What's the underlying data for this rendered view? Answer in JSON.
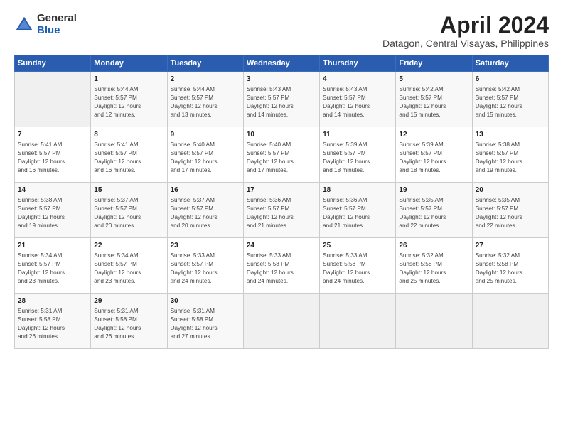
{
  "logo": {
    "general": "General",
    "blue": "Blue"
  },
  "title": "April 2024",
  "subtitle": "Datagon, Central Visayas, Philippines",
  "header_days": [
    "Sunday",
    "Monday",
    "Tuesday",
    "Wednesday",
    "Thursday",
    "Friday",
    "Saturday"
  ],
  "weeks": [
    [
      {
        "day": "",
        "info": ""
      },
      {
        "day": "1",
        "info": "Sunrise: 5:44 AM\nSunset: 5:57 PM\nDaylight: 12 hours\nand 12 minutes."
      },
      {
        "day": "2",
        "info": "Sunrise: 5:44 AM\nSunset: 5:57 PM\nDaylight: 12 hours\nand 13 minutes."
      },
      {
        "day": "3",
        "info": "Sunrise: 5:43 AM\nSunset: 5:57 PM\nDaylight: 12 hours\nand 14 minutes."
      },
      {
        "day": "4",
        "info": "Sunrise: 5:43 AM\nSunset: 5:57 PM\nDaylight: 12 hours\nand 14 minutes."
      },
      {
        "day": "5",
        "info": "Sunrise: 5:42 AM\nSunset: 5:57 PM\nDaylight: 12 hours\nand 15 minutes."
      },
      {
        "day": "6",
        "info": "Sunrise: 5:42 AM\nSunset: 5:57 PM\nDaylight: 12 hours\nand 15 minutes."
      }
    ],
    [
      {
        "day": "7",
        "info": "Sunrise: 5:41 AM\nSunset: 5:57 PM\nDaylight: 12 hours\nand 16 minutes."
      },
      {
        "day": "8",
        "info": "Sunrise: 5:41 AM\nSunset: 5:57 PM\nDaylight: 12 hours\nand 16 minutes."
      },
      {
        "day": "9",
        "info": "Sunrise: 5:40 AM\nSunset: 5:57 PM\nDaylight: 12 hours\nand 17 minutes."
      },
      {
        "day": "10",
        "info": "Sunrise: 5:40 AM\nSunset: 5:57 PM\nDaylight: 12 hours\nand 17 minutes."
      },
      {
        "day": "11",
        "info": "Sunrise: 5:39 AM\nSunset: 5:57 PM\nDaylight: 12 hours\nand 18 minutes."
      },
      {
        "day": "12",
        "info": "Sunrise: 5:39 AM\nSunset: 5:57 PM\nDaylight: 12 hours\nand 18 minutes."
      },
      {
        "day": "13",
        "info": "Sunrise: 5:38 AM\nSunset: 5:57 PM\nDaylight: 12 hours\nand 19 minutes."
      }
    ],
    [
      {
        "day": "14",
        "info": "Sunrise: 5:38 AM\nSunset: 5:57 PM\nDaylight: 12 hours\nand 19 minutes."
      },
      {
        "day": "15",
        "info": "Sunrise: 5:37 AM\nSunset: 5:57 PM\nDaylight: 12 hours\nand 20 minutes."
      },
      {
        "day": "16",
        "info": "Sunrise: 5:37 AM\nSunset: 5:57 PM\nDaylight: 12 hours\nand 20 minutes."
      },
      {
        "day": "17",
        "info": "Sunrise: 5:36 AM\nSunset: 5:57 PM\nDaylight: 12 hours\nand 21 minutes."
      },
      {
        "day": "18",
        "info": "Sunrise: 5:36 AM\nSunset: 5:57 PM\nDaylight: 12 hours\nand 21 minutes."
      },
      {
        "day": "19",
        "info": "Sunrise: 5:35 AM\nSunset: 5:57 PM\nDaylight: 12 hours\nand 22 minutes."
      },
      {
        "day": "20",
        "info": "Sunrise: 5:35 AM\nSunset: 5:57 PM\nDaylight: 12 hours\nand 22 minutes."
      }
    ],
    [
      {
        "day": "21",
        "info": "Sunrise: 5:34 AM\nSunset: 5:57 PM\nDaylight: 12 hours\nand 23 minutes."
      },
      {
        "day": "22",
        "info": "Sunrise: 5:34 AM\nSunset: 5:57 PM\nDaylight: 12 hours\nand 23 minutes."
      },
      {
        "day": "23",
        "info": "Sunrise: 5:33 AM\nSunset: 5:57 PM\nDaylight: 12 hours\nand 24 minutes."
      },
      {
        "day": "24",
        "info": "Sunrise: 5:33 AM\nSunset: 5:58 PM\nDaylight: 12 hours\nand 24 minutes."
      },
      {
        "day": "25",
        "info": "Sunrise: 5:33 AM\nSunset: 5:58 PM\nDaylight: 12 hours\nand 24 minutes."
      },
      {
        "day": "26",
        "info": "Sunrise: 5:32 AM\nSunset: 5:58 PM\nDaylight: 12 hours\nand 25 minutes."
      },
      {
        "day": "27",
        "info": "Sunrise: 5:32 AM\nSunset: 5:58 PM\nDaylight: 12 hours\nand 25 minutes."
      }
    ],
    [
      {
        "day": "28",
        "info": "Sunrise: 5:31 AM\nSunset: 5:58 PM\nDaylight: 12 hours\nand 26 minutes."
      },
      {
        "day": "29",
        "info": "Sunrise: 5:31 AM\nSunset: 5:58 PM\nDaylight: 12 hours\nand 26 minutes."
      },
      {
        "day": "30",
        "info": "Sunrise: 5:31 AM\nSunset: 5:58 PM\nDaylight: 12 hours\nand 27 minutes."
      },
      {
        "day": "",
        "info": ""
      },
      {
        "day": "",
        "info": ""
      },
      {
        "day": "",
        "info": ""
      },
      {
        "day": "",
        "info": ""
      }
    ]
  ]
}
